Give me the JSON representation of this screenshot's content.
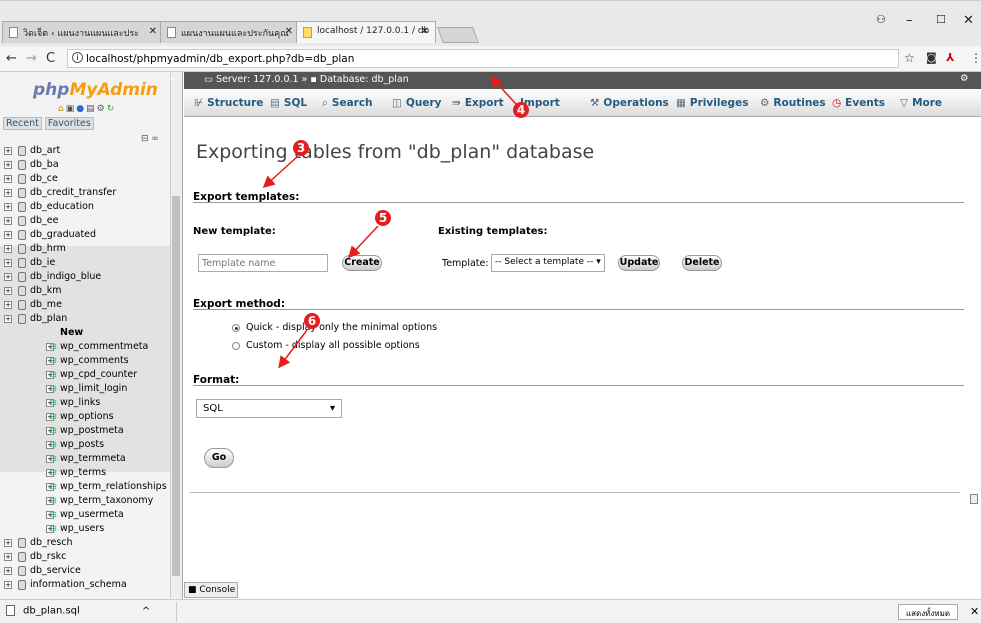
{
  "browser": {
    "tabs": [
      {
        "title": "วิดเจ็ต ‹ แผนงานแผนและประ"
      },
      {
        "title": "แผนงานแผนและประกันคุณ"
      },
      {
        "title": "localhost / 127.0.0.1 / db"
      }
    ],
    "url": "localhost/phpmyadmin/db_export.php?db=db_plan"
  },
  "nav": {
    "logo_a": "php",
    "logo_b": "MyAdmin",
    "recent": "Recent",
    "favorites": "Favorites",
    "databases": [
      "db_art",
      "db_ba",
      "db_ce",
      "db_credit_transfer",
      "db_education",
      "db_ee",
      "db_graduated",
      "db_hrm",
      "db_ie",
      "db_indigo_blue",
      "db_km",
      "db_me",
      "db_plan"
    ],
    "new_label": "New",
    "tables": [
      "wp_commentmeta",
      "wp_comments",
      "wp_cpd_counter",
      "wp_limit_login",
      "wp_links",
      "wp_options",
      "wp_postmeta",
      "wp_posts",
      "wp_termmeta",
      "wp_terms",
      "wp_term_relationships",
      "wp_term_taxonomy",
      "wp_usermeta",
      "wp_users"
    ],
    "databases_after": [
      "db_resch",
      "db_rskc",
      "db_service",
      "information_schema"
    ]
  },
  "breadcrumb": {
    "server": "Server: 127.0.0.1",
    "sep": "»",
    "database": "Database: db_plan"
  },
  "tabs": [
    "Structure",
    "SQL",
    "Search",
    "Query",
    "Export",
    "Import",
    "Operations",
    "Privileges",
    "Routines",
    "Events",
    "More"
  ],
  "main": {
    "heading": "Exporting tables from \"db_plan\" database",
    "export_templates": "Export templates:",
    "new_template": "New template:",
    "existing_templates": "Existing templates:",
    "template_placeholder": "Template name",
    "create": "Create",
    "template_label": "Template:",
    "template_select": "-- Select a template --",
    "update": "Update",
    "delete": "Delete",
    "export_method": "Export method:",
    "quick": "Quick - display only the minimal options",
    "custom": "Custom - display all possible options",
    "format": "Format:",
    "format_value": "SQL",
    "go": "Go",
    "console": "Console"
  },
  "download": {
    "file": "db_plan.sql",
    "show_all": "แสดงทั้งหมด"
  },
  "markers": [
    "3",
    "4",
    "5",
    "6"
  ],
  "colors": {
    "accent": "#235a81",
    "marker": "#e31e1e",
    "topbar": "#555555"
  }
}
